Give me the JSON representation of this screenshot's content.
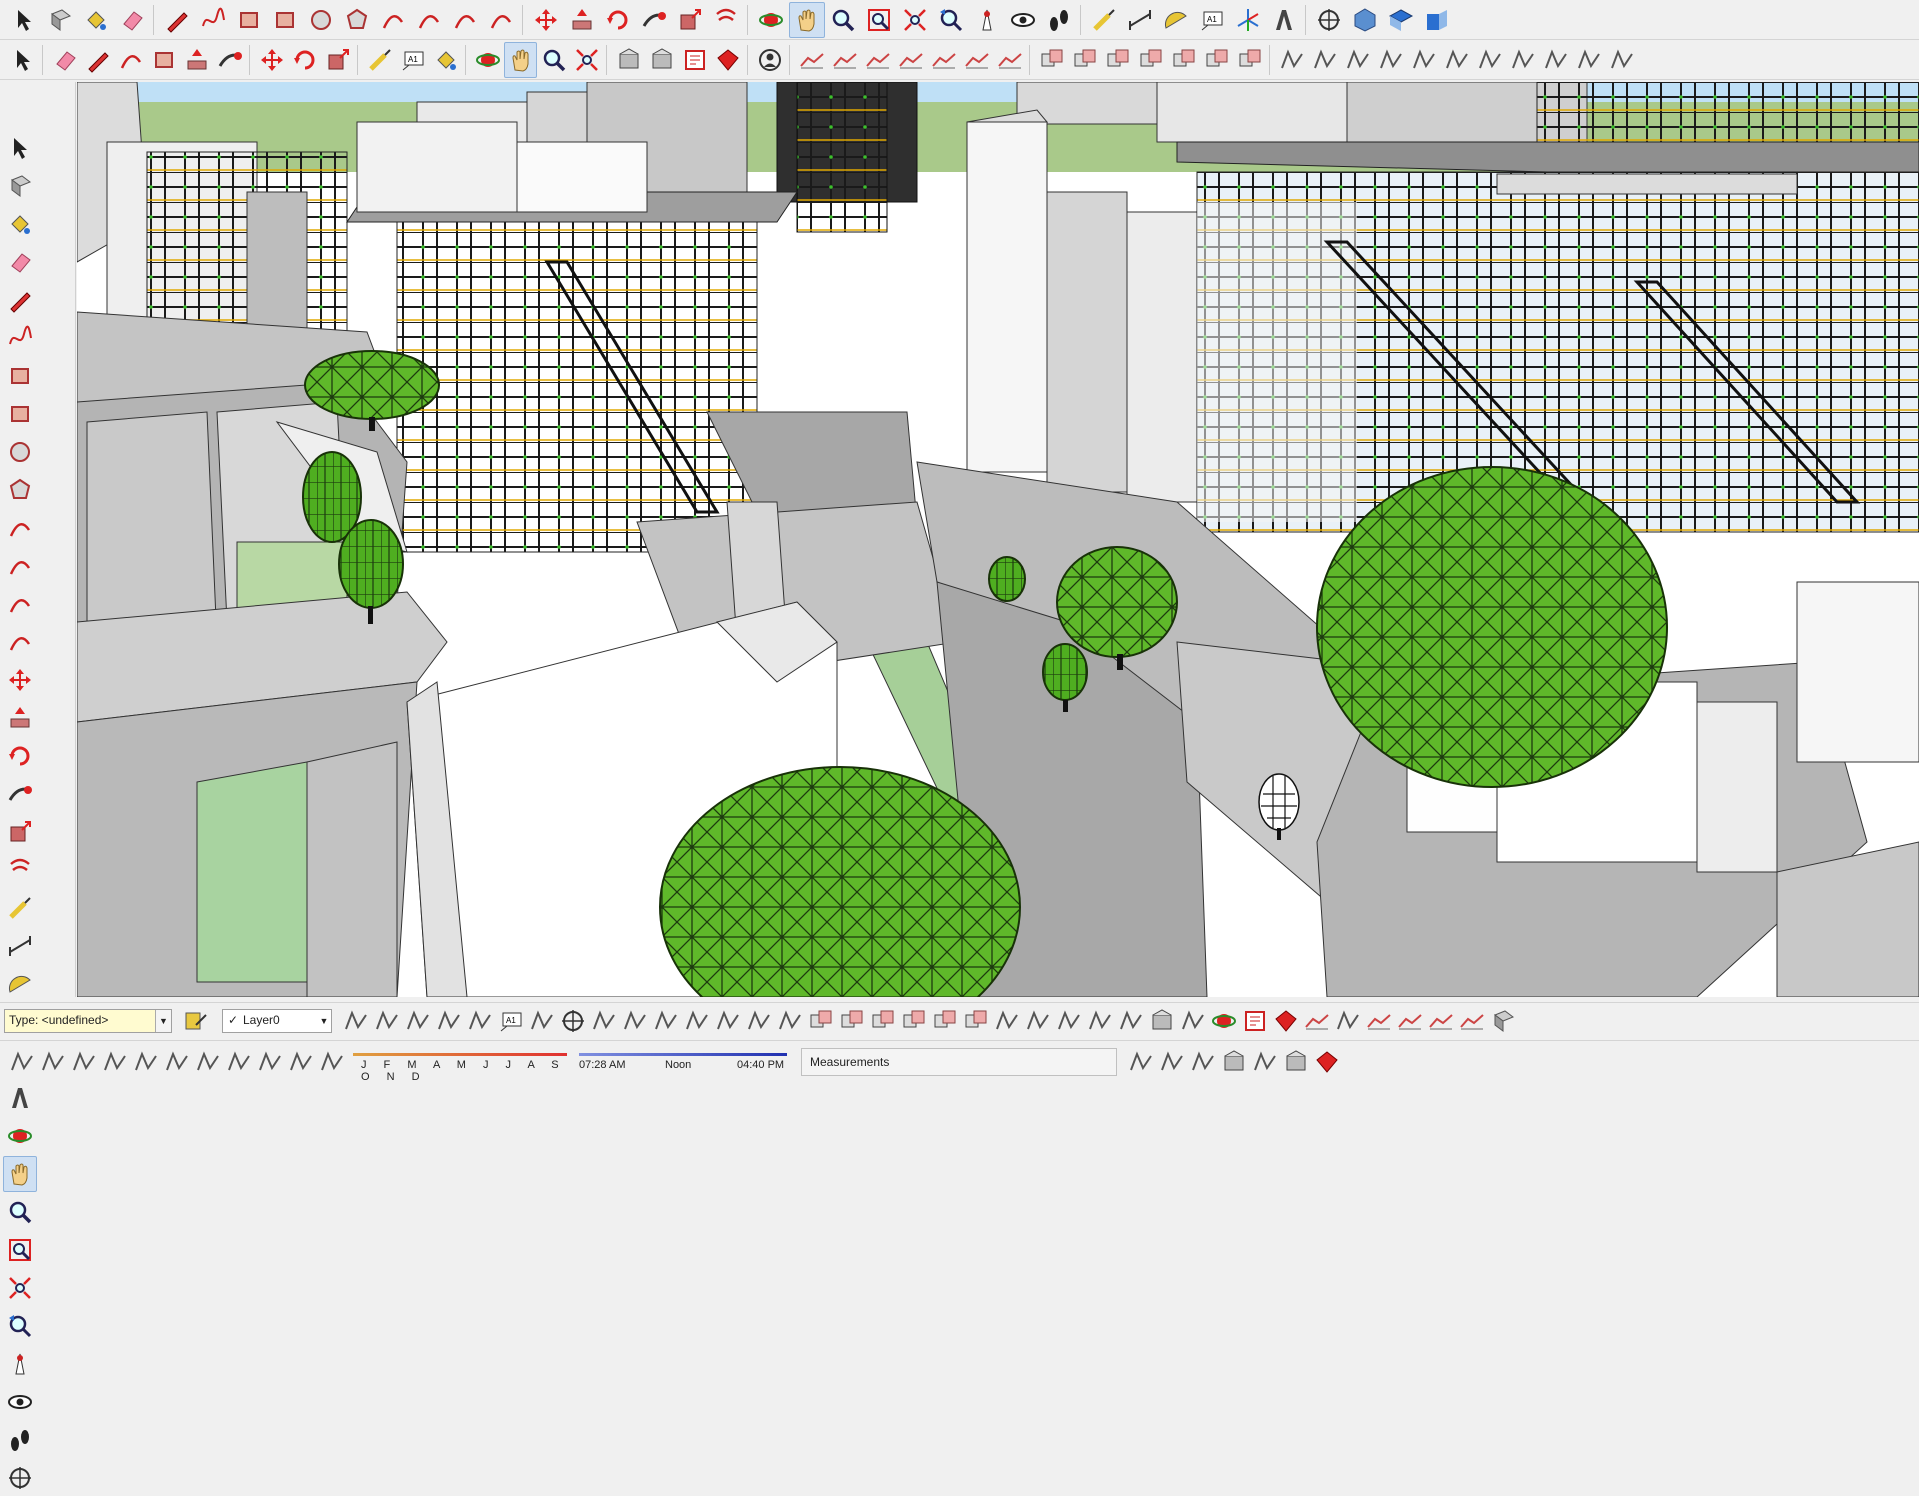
{
  "toolbar_top": {
    "icons": [
      "select-icon",
      "component-icon",
      "paint-bucket-icon",
      "eraser-icon",
      "line-icon",
      "freehand-icon",
      "rectangle-icon",
      "rotated-rectangle-icon",
      "circle-icon",
      "polygon-icon",
      "arc-icon",
      "two-point-arc-icon",
      "three-point-arc-icon",
      "pie-icon",
      "move-icon",
      "push-pull-icon",
      "rotate-icon",
      "follow-me-icon",
      "scale-icon",
      "offset-icon",
      "orbit-icon",
      "pan-icon",
      "zoom-icon",
      "zoom-window-icon",
      "zoom-extents-icon",
      "previous-view-icon",
      "position-camera-icon",
      "look-around-icon",
      "walk-icon",
      "tape-measure-icon",
      "dimension-icon",
      "protractor-icon",
      "text-icon",
      "axes-icon",
      "3d-text-icon",
      "section-plane-icon",
      "iso-view-icon",
      "top-view-icon",
      "front-view-icon"
    ],
    "active": "pan-icon"
  },
  "toolbar_second": {
    "icons": [
      "select-icon",
      "eraser-icon",
      "pencil-icon",
      "arc-dropdown-icon",
      "rectangle-dropdown-icon",
      "push-pull-icon",
      "follow-me-icon",
      "move-icon",
      "rotate-icon",
      "scale-icon",
      "tape-measure-icon",
      "text-icon",
      "paint-bucket-icon",
      "orbit-icon",
      "pan-icon",
      "zoom-icon",
      "zoom-extents-icon",
      "warehouse-icon",
      "extension-warehouse-icon",
      "layout-icon",
      "ruby-icon",
      "account-icon",
      "sandbox-from-contours-icon",
      "sandbox-from-scratch-icon",
      "smoove-icon",
      "stamp-icon",
      "drape-icon",
      "add-detail-icon",
      "flip-edge-icon",
      "solid-union-icon",
      "solid-subtract-icon",
      "trim-icon",
      "split-icon",
      "outer-shell-icon",
      "intersect-icon",
      "shell-icon",
      "profile-icon",
      "corner-icon",
      "stairs-icon",
      "railing-icon",
      "wall-icon",
      "window-icon",
      "door-icon",
      "roof-icon",
      "beam-icon",
      "column-icon",
      "slab-icon"
    ],
    "active": "pan-icon"
  },
  "toolbar_left": {
    "icons": [
      "select-icon",
      "make-component-icon",
      "paint-bucket-icon",
      "eraser-icon",
      "line-icon",
      "freehand-icon",
      "rectangle-icon",
      "rotated-rectangle-icon",
      "circle-icon",
      "polygon-icon",
      "arc-icon",
      "two-point-arc-icon",
      "three-point-arc-icon",
      "pie-icon",
      "move-icon",
      "push-pull-icon",
      "rotate-icon",
      "follow-me-icon",
      "scale-icon",
      "offset-icon",
      "tape-measure-icon",
      "dimension-icon",
      "protractor-icon",
      "text-icon",
      "axes-icon",
      "3d-text-icon",
      "orbit-icon",
      "pan-icon",
      "zoom-icon",
      "zoom-window-icon",
      "zoom-extents-icon",
      "previous-view-icon",
      "position-camera-icon",
      "look-around-icon",
      "walk-icon",
      "section-plane-icon"
    ],
    "active": "pan-icon"
  },
  "entity_info": {
    "type_value": "Type: <undefined>",
    "layer_value": "Layer0"
  },
  "shadows": {
    "months": "J F M A M J J A S O N D",
    "time_start": "07:28 AM",
    "time_mid": "Noon",
    "time_end": "04:40 PM"
  },
  "measurements": {
    "label": "Measurements"
  },
  "colors": {
    "toolbar_bg": "#f0f0f0",
    "sky": "#bfe0f6",
    "ground": "#a9c98a",
    "building_gray": "#b4b4b4",
    "tree_green": "#5fb82a",
    "steel_yellow": "#e0a800",
    "active_tool": "#cfe0f3"
  }
}
